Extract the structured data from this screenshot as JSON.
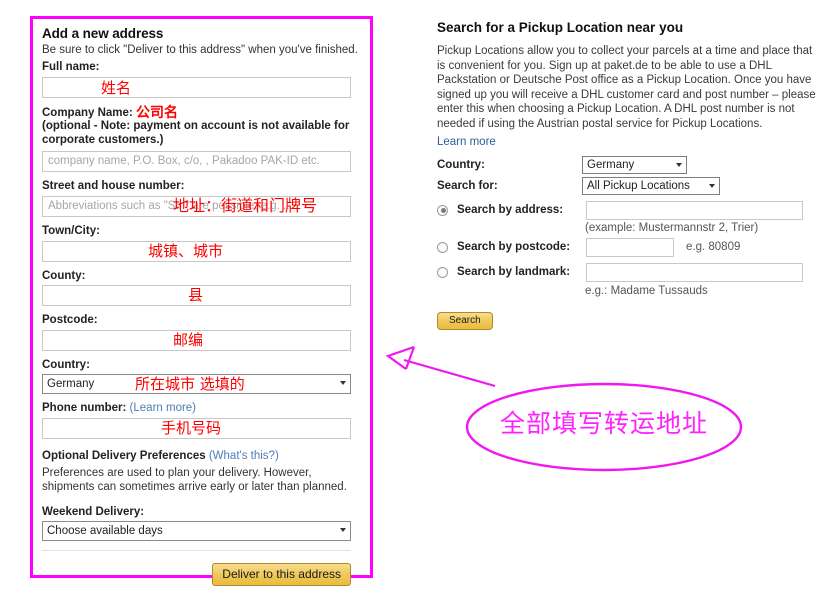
{
  "annotations": {
    "accent_color": "#ff00ff",
    "red_color": "#ff0000",
    "ellipse_note": "全部填写转运地址",
    "arrow": "arrow-pointing-to-address-form"
  },
  "address_form": {
    "title": "Add a new address",
    "subtitle": "Be sure to click \"Deliver to this address\" when you've finished.",
    "fields": {
      "full_name": {
        "label": "Full name:",
        "placeholder": "",
        "annotation": "姓名"
      },
      "company_name": {
        "label": "Company Name:",
        "note": "(optional - Note: payment on account is not available for corporate customers.)",
        "placeholder": "company name, P.O. Box, c/o, , Pakadoo PAK-ID etc.",
        "annotation": "公司名"
      },
      "street": {
        "label": "Street and house number:",
        "placeholder": "Abbreviations such as \"Str.\" are possible, e.g. ...",
        "annotation": "地址：街道和门牌号"
      },
      "town_city": {
        "label": "Town/City:",
        "placeholder": "",
        "annotation": "城镇、城市"
      },
      "county": {
        "label": "County:",
        "placeholder": "",
        "annotation": "县"
      },
      "postcode": {
        "label": "Postcode:",
        "placeholder": "",
        "annotation": "邮编"
      },
      "country": {
        "label": "Country:",
        "value": "Germany",
        "annotation": "所在城市 选填的"
      },
      "phone": {
        "label": "Phone number:",
        "link": "(Learn more)",
        "placeholder": "",
        "annotation": "手机号码"
      }
    },
    "delivery_prefs": {
      "heading": "Optional Delivery Preferences",
      "link": "(What's this?)",
      "description": "Preferences are used to plan your delivery. However, shipments can sometimes arrive early or later than planned.",
      "weekend_label": "Weekend Delivery:",
      "weekend_value": "Choose available days"
    },
    "submit_label": "Deliver to this address"
  },
  "pickup_panel": {
    "title": "Search for a Pickup Location near you",
    "description": "Pickup Locations allow you to collect your parcels at a time and place that is convenient for you. Sign up at paket.de to be able to use a DHL Packstation or Deutsche Post office as a Pickup Location. Once you have signed up you will receive a DHL customer card and post number – please enter this when choosing a Pickup Location. A DHL post number is not needed if using the Austrian postal service for Pickup Locations.",
    "learn_more": "Learn more",
    "country_label": "Country:",
    "country_value": "Germany",
    "search_for_label": "Search for:",
    "search_for_value": "All Pickup Locations",
    "options": [
      {
        "label": "Search by address:",
        "value": "",
        "hint": "(example: Mustermannstr 2, Trier)",
        "selected": true
      },
      {
        "label": "Search by postcode:",
        "value": "",
        "hint": "e.g. 80809",
        "selected": false
      },
      {
        "label": "Search by landmark:",
        "value": "",
        "hint": "e.g.: Madame Tussauds",
        "selected": false
      }
    ],
    "search_button": "Search"
  }
}
